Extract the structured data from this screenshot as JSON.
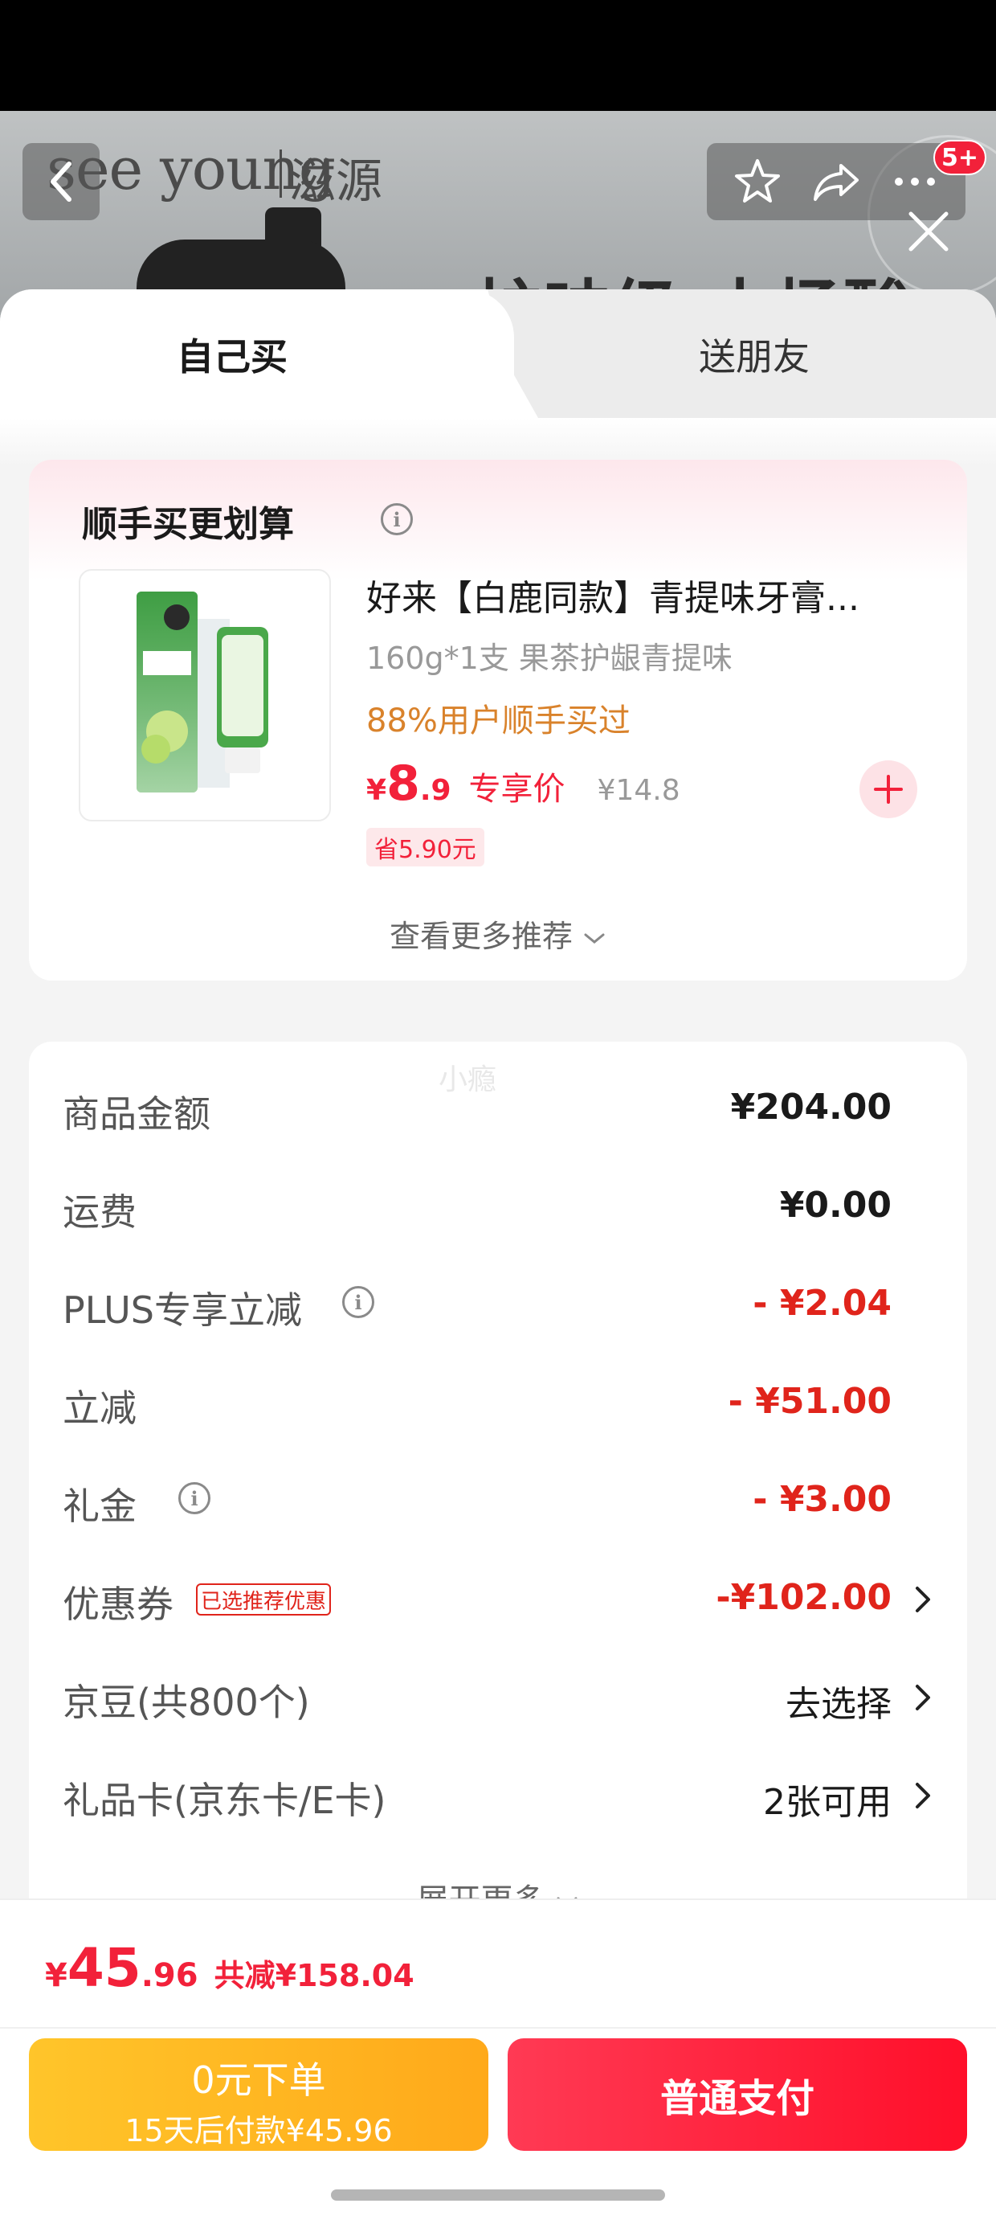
{
  "background_page": {
    "brand_en": "see young",
    "brand_cn": "滋源",
    "slogan": "护味级 水杨酸",
    "cart_badge": "5+"
  },
  "tabs": {
    "self": "自己买",
    "friend": "送朋友"
  },
  "recommend": {
    "title": "顺手买更划算",
    "product_name": "好来【白鹿同款】青提味牙膏...",
    "spec": "160g*1支 果茶护龈青提味",
    "popularity": "88%用户顺手买过",
    "price_yen": "¥",
    "price_int": "8",
    "price_dec": ".9",
    "price_tag": "专享价",
    "original_price": "¥14.8",
    "save_tag": "省5.90元",
    "see_more": "查看更多推荐"
  },
  "details": {
    "watermark": "小瘾",
    "rows": [
      {
        "label": "商品金额",
        "value": "¥204.00"
      },
      {
        "label": "运费",
        "value": "¥0.00"
      },
      {
        "label": "PLUS专享立减",
        "value": "- ¥2.04"
      },
      {
        "label": "立减",
        "value": "- ¥51.00"
      },
      {
        "label": "礼金",
        "value": "- ¥3.00"
      },
      {
        "label": "优惠券",
        "tag": "已选推荐优惠",
        "value": "-¥102.00"
      },
      {
        "label": "京豆(共800个)",
        "value": "去选择"
      },
      {
        "label": "礼品卡(京东卡/E卡)",
        "value": "2张可用"
      }
    ],
    "expand_more": "展开更多"
  },
  "footer": {
    "total_yen": "¥",
    "total_int": "45",
    "total_dec": ".96",
    "total_saved": "共减¥158.04",
    "pay_later_title": "0元下单",
    "pay_later_sub": "15天后付款¥45.96",
    "pay_now": "普通支付"
  },
  "colors": {
    "accent_red": "#f2213a",
    "discount_red": "#e0241b",
    "pay_later_yellow": "#ffb81f"
  }
}
